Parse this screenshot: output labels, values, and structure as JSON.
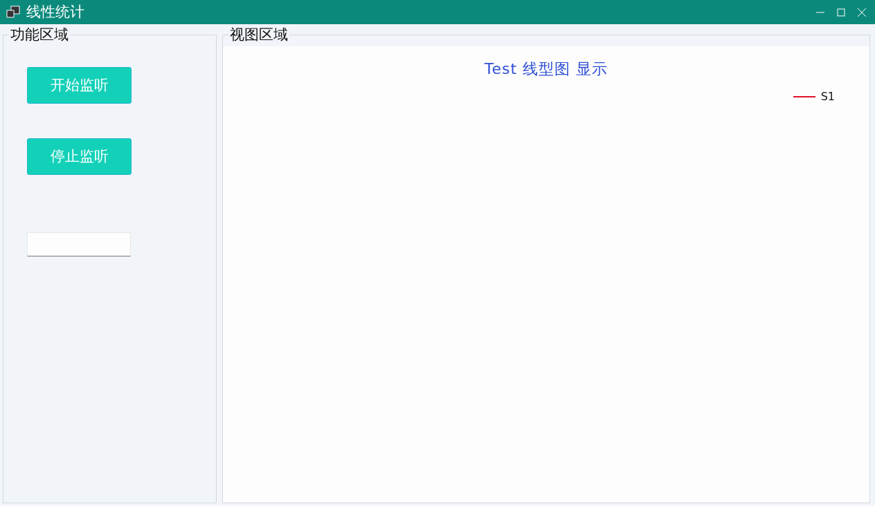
{
  "window": {
    "title": "线性统计"
  },
  "function_group": {
    "title": "功能区域",
    "buttons": [
      "开始监听",
      "停止监听"
    ]
  },
  "view_group": {
    "title": "视图区域",
    "chart": {
      "title": "Test 线型图 显示",
      "legend": [
        {
          "name": "S1",
          "color": "#e0102a"
        }
      ]
    }
  }
}
